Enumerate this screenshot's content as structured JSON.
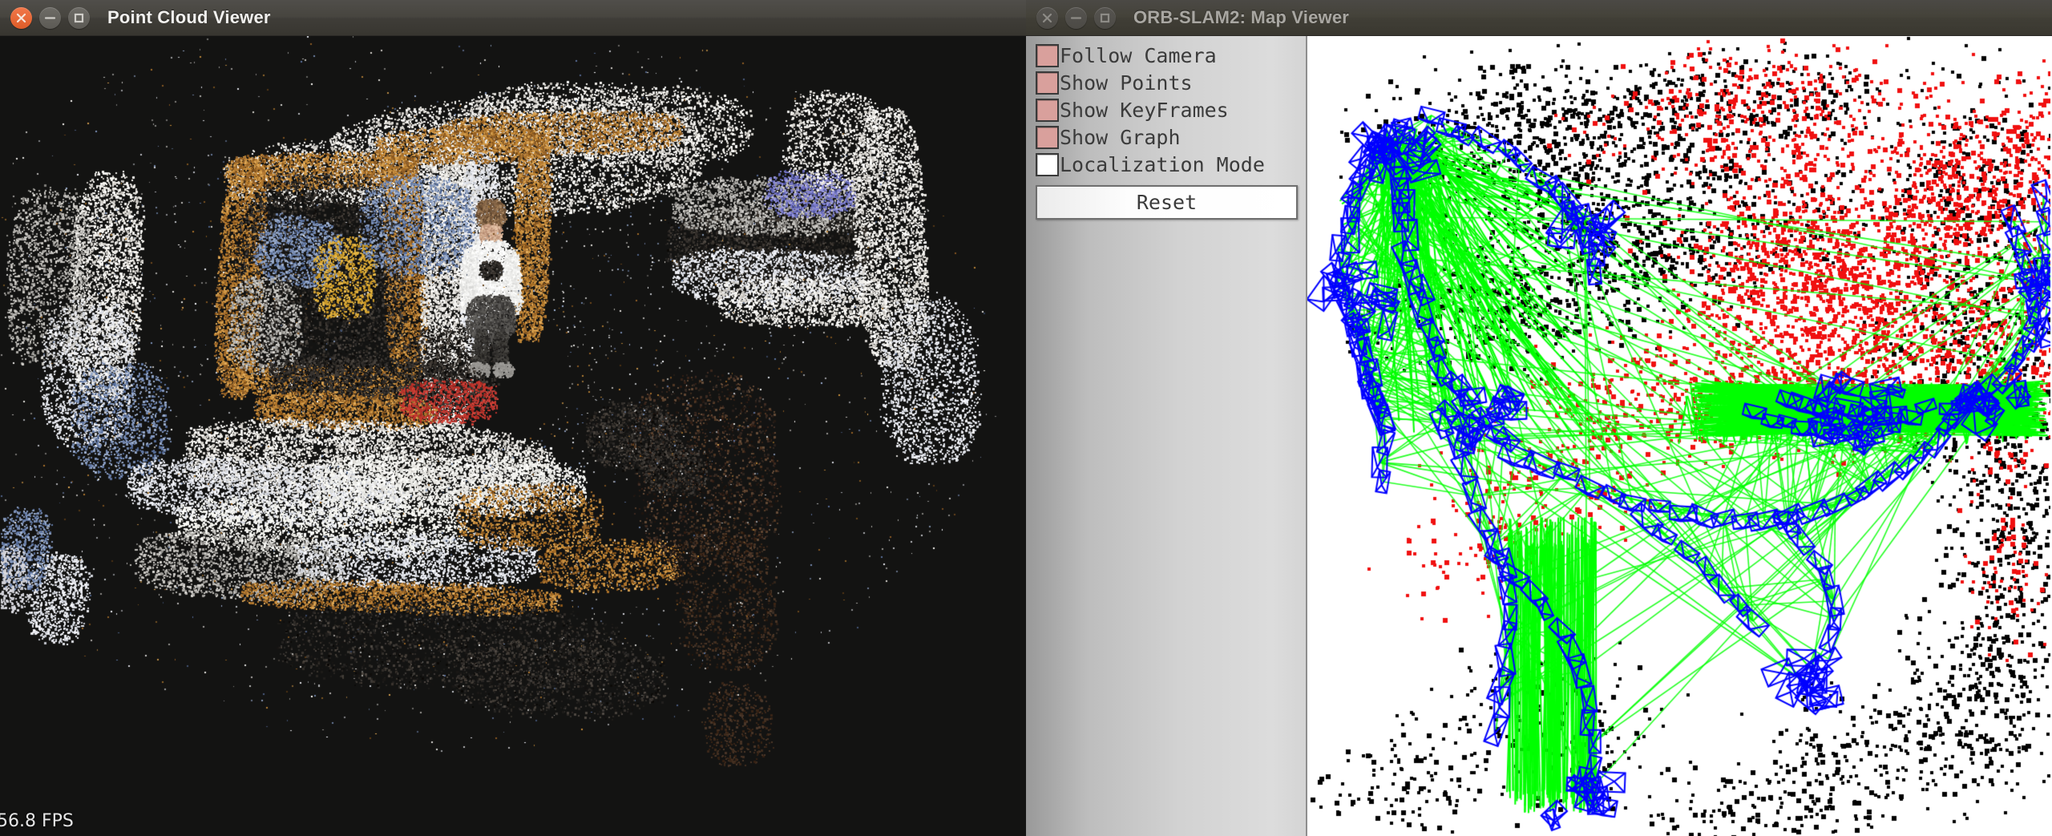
{
  "windows": {
    "left": {
      "title": "Point Cloud Viewer",
      "active": true,
      "buttons": {
        "close": "close-icon",
        "minimize": "minimize-icon",
        "maximize": "maximize-icon"
      },
      "overlay": {
        "fps": "56.8 FPS"
      },
      "viewport": {
        "background_color": "#131312",
        "kind": "rgb-point-cloud",
        "scene": "indoor room with person"
      }
    },
    "right": {
      "title": "ORB-SLAM2: Map Viewer",
      "active": false,
      "buttons": {
        "close": "close-icon",
        "minimize": "minimize-icon",
        "maximize": "maximize-icon"
      },
      "panel": {
        "checkboxes": [
          {
            "label": "Follow Camera",
            "checked": true
          },
          {
            "label": "Show Points",
            "checked": true
          },
          {
            "label": "Show KeyFrames",
            "checked": true
          },
          {
            "label": "Show Graph",
            "checked": true
          },
          {
            "label": "Localization Mode",
            "checked": false
          }
        ],
        "reset_label": "Reset",
        "checked_color": "#d9a09c",
        "unchecked_color": "#ffffff"
      },
      "viewport": {
        "background_color": "#ffffff",
        "kind": "slam-map",
        "legend": {
          "keyframes_color": "#0000ff",
          "graph_color": "#00ff00",
          "map_points_color": "#000000",
          "recent_points_color": "#f01010"
        }
      }
    }
  },
  "theme": {
    "titlebar_active": "#47453f",
    "titlebar_inactive": "#444239",
    "close_button_color": "#e8652f",
    "panel_gradient_from": "#999999",
    "panel_gradient_to": "#dcdcdc"
  }
}
